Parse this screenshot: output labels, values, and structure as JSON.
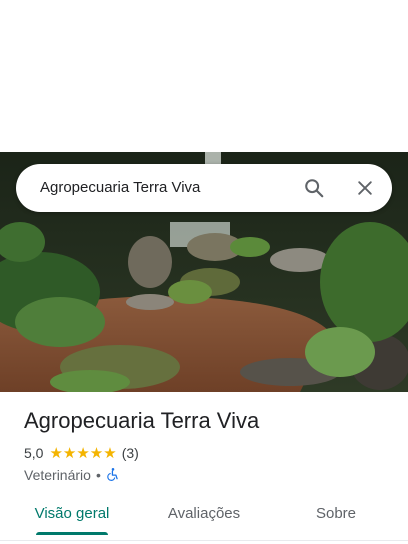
{
  "search": {
    "query": "Agropecuaria Terra Viva"
  },
  "place": {
    "name": "Agropecuaria Terra Viva",
    "rating": "5,0",
    "stars": "★★★★★",
    "review_count": "(3)",
    "category": "Veterinário",
    "separator": "•"
  },
  "tabs": [
    {
      "label": "Visão geral"
    },
    {
      "label": "Avaliações"
    },
    {
      "label": "Sobre"
    }
  ],
  "colors": {
    "accent": "#00796b",
    "star": "#f4b400",
    "accessibility": "#1a73e8"
  },
  "icons": [
    "search-icon",
    "close-icon",
    "wheelchair-icon"
  ]
}
